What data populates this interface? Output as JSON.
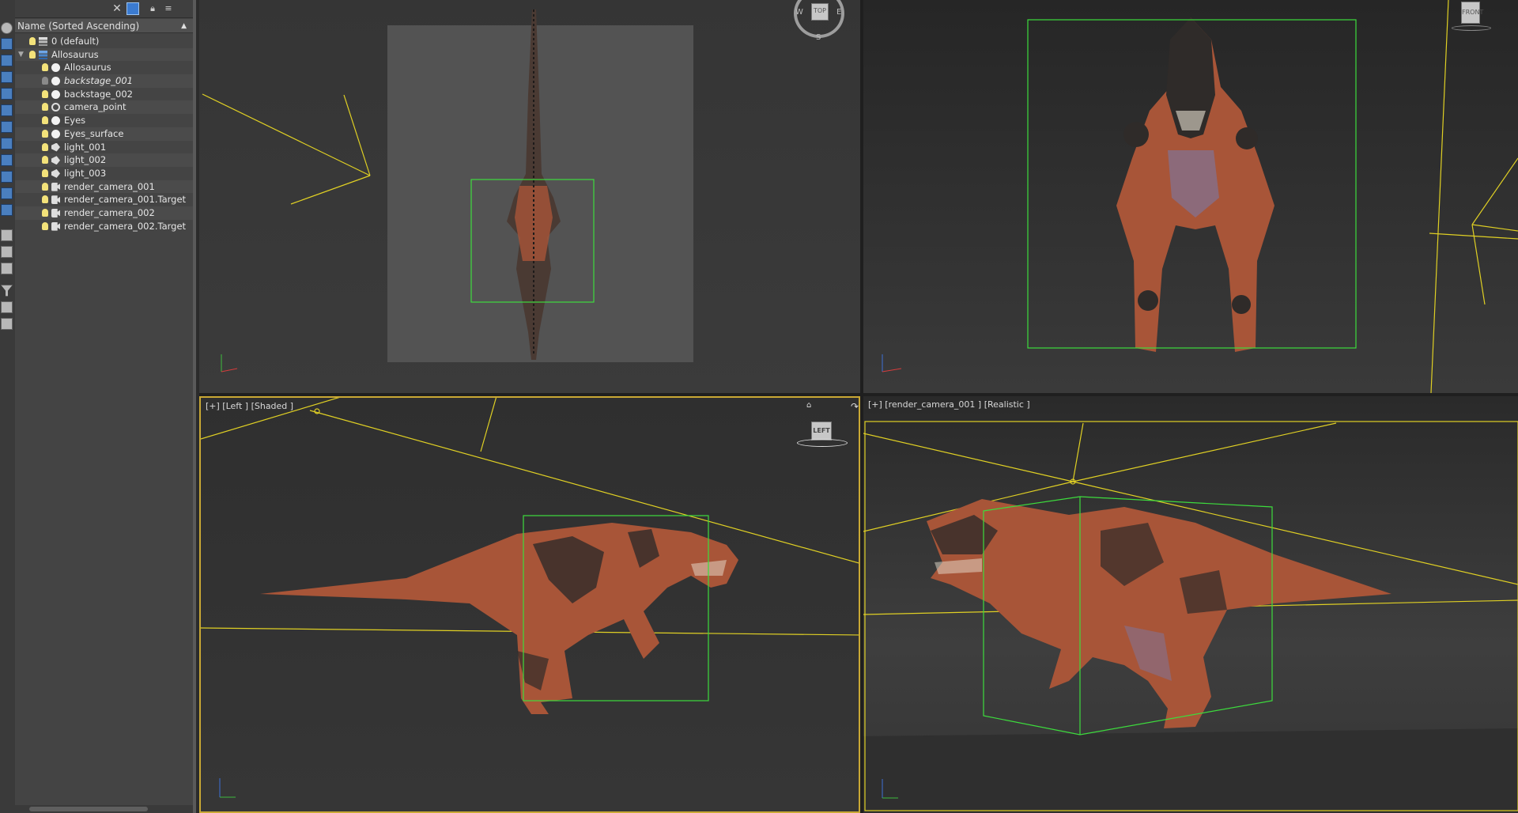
{
  "explorer": {
    "header": "Name (Sorted Ascending)",
    "sort_arrow": "▲",
    "close_glyph": "✕",
    "items": [
      {
        "label": "0 (default)",
        "icon": "layer-icon",
        "indent": 0,
        "bulb": "on",
        "italic": false,
        "expander": ""
      },
      {
        "label": "Allosaurus",
        "icon": "layer-blue-icon",
        "indent": 0,
        "bulb": "on",
        "italic": false,
        "expander": "▼"
      },
      {
        "label": "Allosaurus",
        "icon": "sphere-icon",
        "indent": 1,
        "bulb": "on",
        "italic": false,
        "expander": ""
      },
      {
        "label": "backstage_001",
        "icon": "sphere-icon",
        "indent": 1,
        "bulb": "off",
        "italic": true,
        "expander": ""
      },
      {
        "label": "backstage_002",
        "icon": "sphere-icon",
        "indent": 1,
        "bulb": "on",
        "italic": false,
        "expander": ""
      },
      {
        "label": "camera_point",
        "icon": "helper-icon",
        "indent": 1,
        "bulb": "on",
        "italic": false,
        "expander": ""
      },
      {
        "label": "Eyes",
        "icon": "sphere-icon",
        "indent": 1,
        "bulb": "on",
        "italic": false,
        "expander": ""
      },
      {
        "label": "Eyes_surface",
        "icon": "sphere-icon",
        "indent": 1,
        "bulb": "on",
        "italic": false,
        "expander": ""
      },
      {
        "label": "light_001",
        "icon": "light-icon",
        "indent": 1,
        "bulb": "on",
        "italic": false,
        "expander": ""
      },
      {
        "label": "light_002",
        "icon": "light-icon",
        "indent": 1,
        "bulb": "on",
        "italic": false,
        "expander": ""
      },
      {
        "label": "light_003",
        "icon": "light-icon",
        "indent": 1,
        "bulb": "on",
        "italic": false,
        "expander": ""
      },
      {
        "label": "render_camera_001",
        "icon": "camera-icon",
        "indent": 1,
        "bulb": "on",
        "italic": false,
        "expander": ""
      },
      {
        "label": "render_camera_001.Target",
        "icon": "camera-icon",
        "indent": 1,
        "bulb": "on",
        "italic": false,
        "expander": ""
      },
      {
        "label": "render_camera_002",
        "icon": "camera-icon",
        "indent": 1,
        "bulb": "on",
        "italic": false,
        "expander": ""
      },
      {
        "label": "render_camera_002.Target",
        "icon": "camera-icon",
        "indent": 1,
        "bulb": "on",
        "italic": false,
        "expander": ""
      }
    ]
  },
  "viewports": {
    "top": {
      "label": "",
      "compass": {
        "top": "TOP",
        "w": "W",
        "e": "E",
        "s": "S"
      }
    },
    "front": {
      "label": "",
      "cube": "FRONT"
    },
    "left": {
      "label": "[+] [Left ] [Shaded ]",
      "cube": "LEFT"
    },
    "camera": {
      "label": "[+] [render_camera_001 ] [Realistic ]"
    }
  },
  "colors": {
    "selection_box": "#3ddc3d",
    "camera_lines": "#e0d024",
    "active_border": "#c9a834",
    "dino_skin": "#a85538",
    "dino_dark": "#2f2b29",
    "dino_belly": "#8c6a7a"
  }
}
